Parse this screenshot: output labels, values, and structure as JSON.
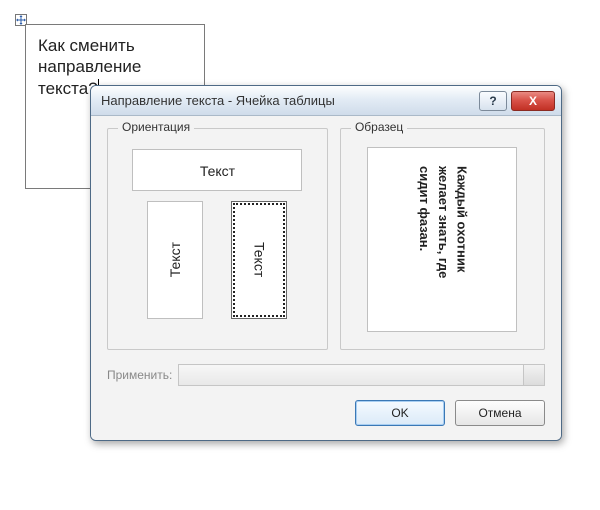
{
  "cell": {
    "text": "Как сменить направление текста?"
  },
  "dialog": {
    "title": "Направление текста - Ячейка таблицы",
    "help_symbol": "?",
    "close_symbol": "X",
    "orientation": {
      "legend": "Ориентация",
      "horizontal_label": "Текст",
      "vertical_left_label": "Текст",
      "vertical_right_label": "Текст"
    },
    "sample": {
      "legend": "Образец",
      "text": "Каждый охотник желает знать, где сидит фазан."
    },
    "apply_label": "Применить:",
    "apply_value": "",
    "ok_label": "OK",
    "cancel_label": "Отмена"
  }
}
